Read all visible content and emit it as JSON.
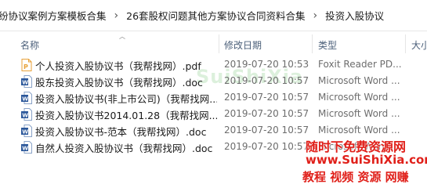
{
  "breadcrumb": {
    "items": [
      "纷协议案例方案模板合集",
      "26套股权问题其他方案协议合同资料合集",
      "投资入股协议"
    ],
    "separator": "›"
  },
  "columns": {
    "name": "名称",
    "modified": "修改日期",
    "type": "类型",
    "size": "大小"
  },
  "files": [
    {
      "name": "个人投资入股协议书（我帮找网）.pdf",
      "modified": "2019-07-20 10:53",
      "type": "Foxit Reader PD...",
      "icon": "pdf-file-icon"
    },
    {
      "name": "股东投资入股协议书（我帮找网）.doc",
      "modified": "2019-07-20 10:57",
      "type": "Microsoft Word ...",
      "icon": "word-file-icon"
    },
    {
      "name": "投资入股协议书(非上市公司)（我帮找网...",
      "modified": "2019-07-20 10:57",
      "type": "Microsoft Word ...",
      "icon": "word-file-icon"
    },
    {
      "name": "投资入股协议书2014.01.28（我帮找网...",
      "modified": "2019-07-20 10:57",
      "type": "Microsoft Word ...",
      "icon": "word-file-icon"
    },
    {
      "name": "投资入股协议书-范本（我帮找网）.doc",
      "modified": "2019-07-20 10:57",
      "type": "Microsoft Word ...",
      "icon": "word-file-icon"
    },
    {
      "name": "自然人投资入股协议书（我帮找网）.doc",
      "modified": "2019-07-20 10:57",
      "type": "Microsoft Word ...",
      "icon": "word-file-icon"
    }
  ],
  "watermarks": {
    "background": "SuiShiXia",
    "line1": "随时下免费资源网",
    "line2": "www.SuiShiXia.com",
    "line3": "教程 视频 资源 网赚"
  },
  "colors": {
    "header_text": "#4c607a",
    "watermark_red": "#e0201a",
    "pdf_icon": "#e8a23a",
    "word_icon": "#2b579a"
  }
}
